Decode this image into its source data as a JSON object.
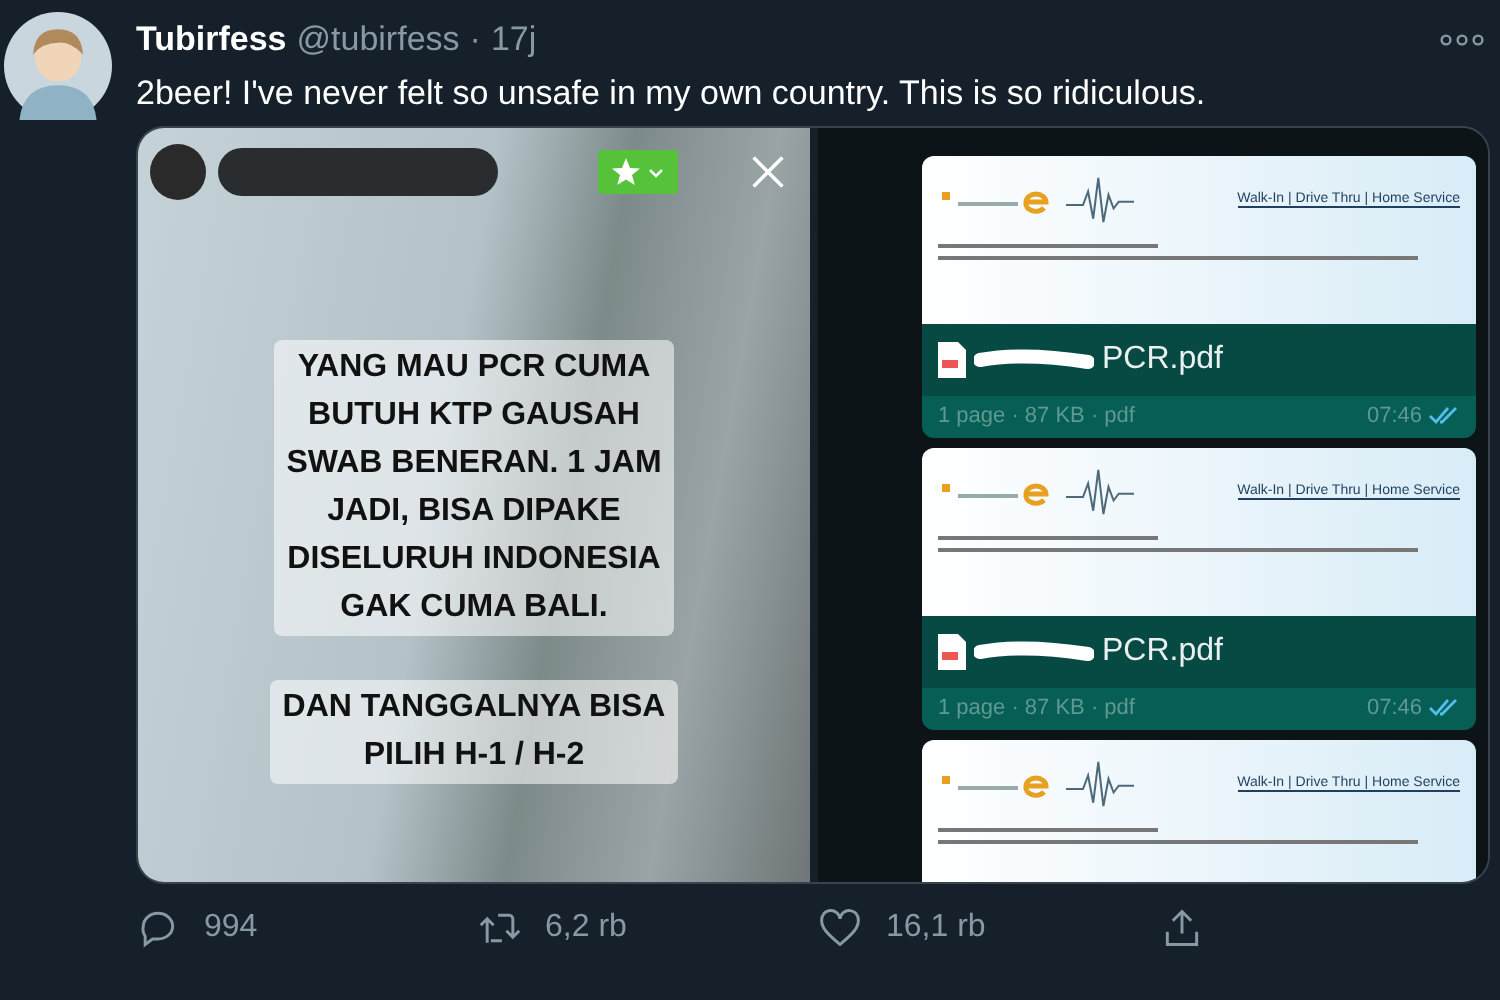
{
  "tweet": {
    "author": {
      "name": "Tubirfess",
      "handle": "@tubirfess",
      "separator": "·",
      "time": "17j"
    },
    "text": "2beer! I've never felt so unsafe in my own country. This is so ridiculous.",
    "story": {
      "paragraphs": [
        "YANG MAU PCR CUMA\nBUTUH KTP GAUSAH\nSWAB BENERAN. 1 JAM\nJADI, BISA DIPAKE\nDISELURUH INDONESIA\nGAK CUMA BALI.",
        "DAN TANGGALNYA BISA\nPILIH H-1 / H-2"
      ]
    },
    "chat": {
      "messages": [
        {
          "letterhead": "Walk-In | Drive Thru | Home Service",
          "file_name": "PCR.pdf",
          "meta": "1 page · 87 KB · pdf",
          "time": "07:46",
          "read": true
        },
        {
          "letterhead": "Walk-In | Drive Thru | Home Service",
          "file_name": "PCR.pdf",
          "meta": "1 page · 87 KB · pdf",
          "time": "07:46",
          "read": true
        },
        {
          "letterhead": "Walk-In | Drive Thru | Home Service"
        }
      ]
    },
    "actions": [
      {
        "kind": "reply",
        "count": "994"
      },
      {
        "kind": "retweet",
        "count": "6,2 rb"
      },
      {
        "kind": "like",
        "count": "16,1 rb"
      },
      {
        "kind": "share"
      }
    ]
  }
}
